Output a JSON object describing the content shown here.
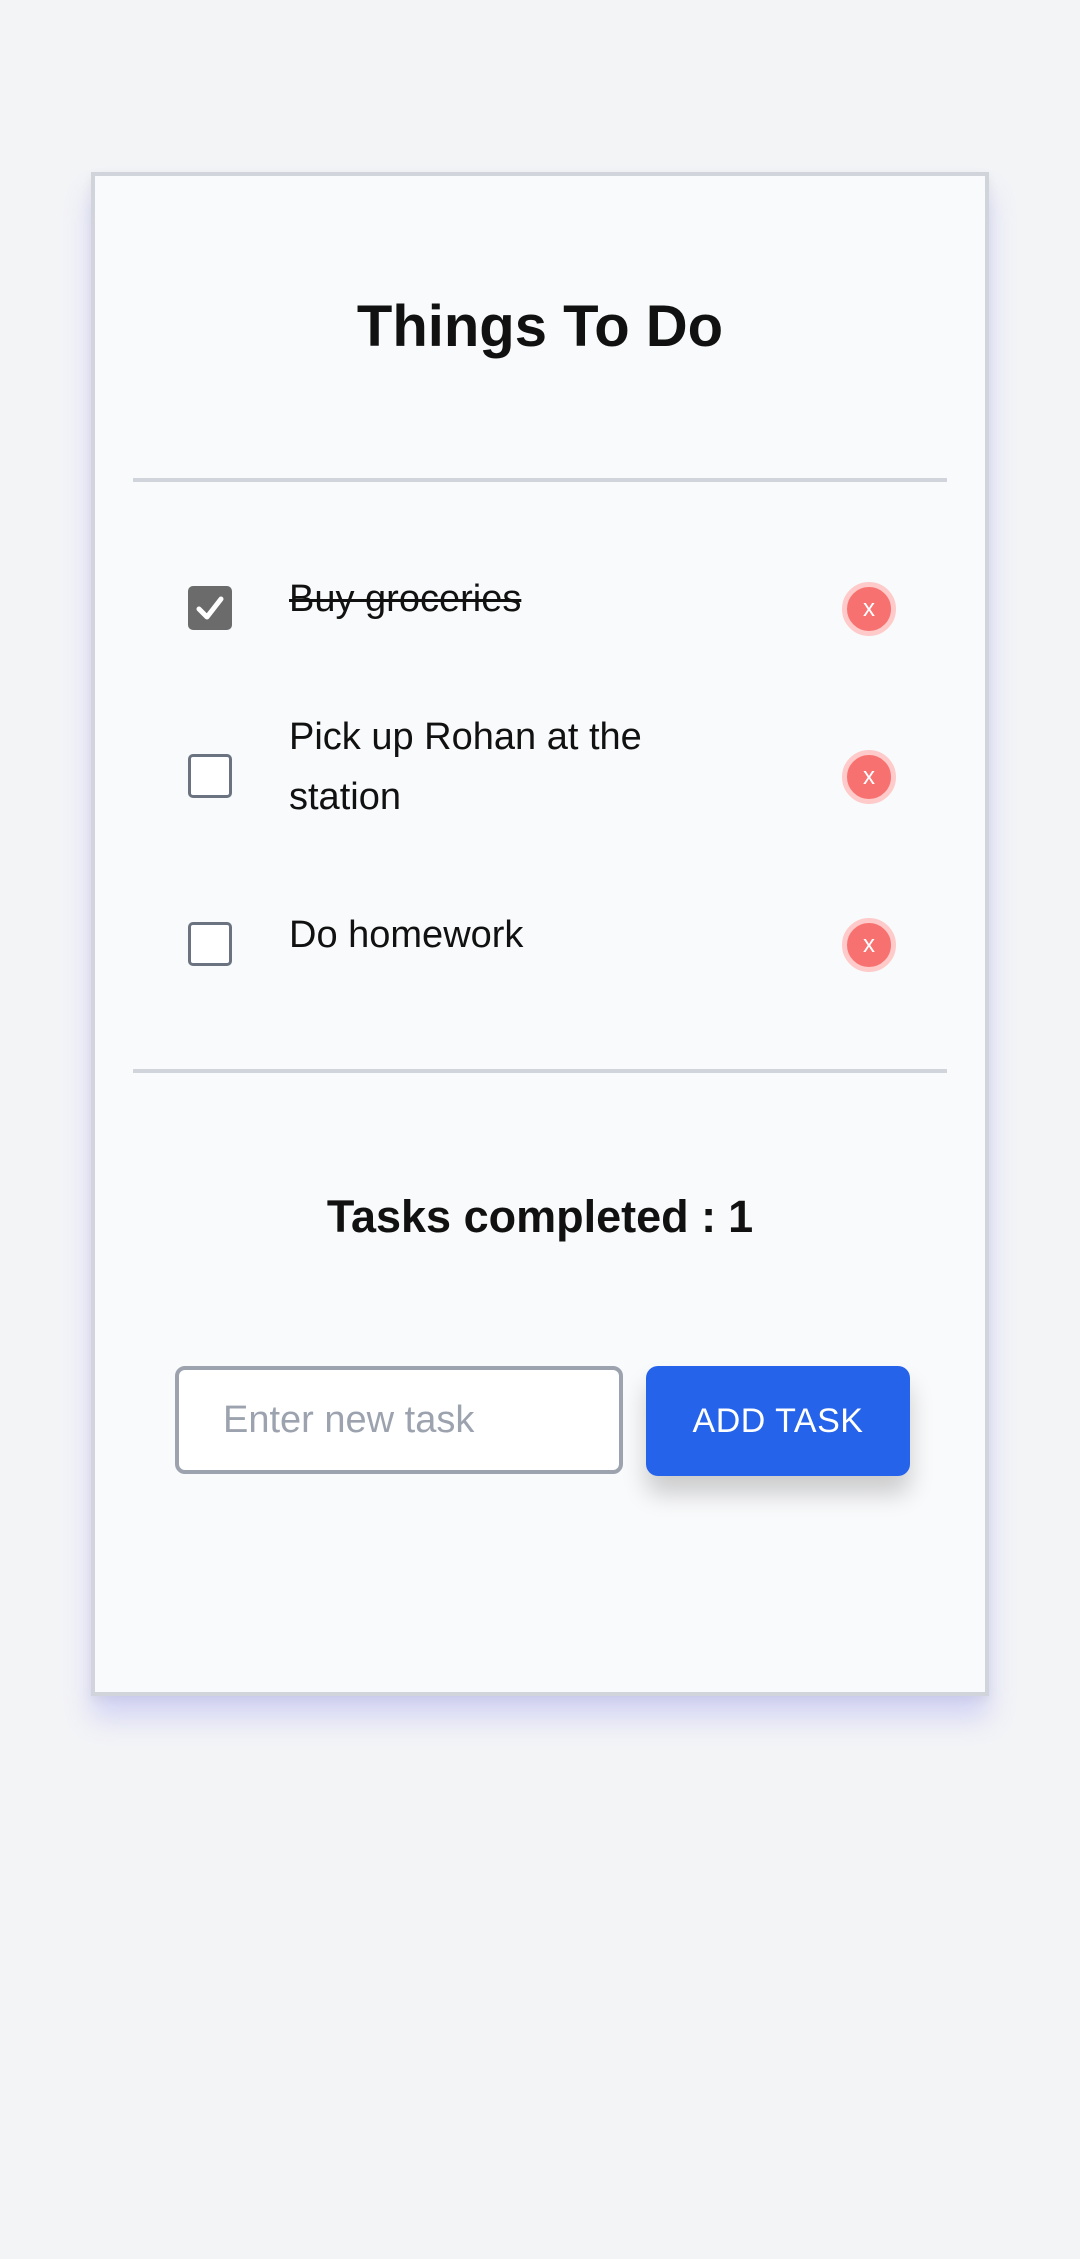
{
  "app": {
    "title": "Things To Do"
  },
  "tasks": [
    {
      "label": "Buy groceries",
      "completed": true
    },
    {
      "label": "Pick up Rohan at the station",
      "completed": false
    },
    {
      "label": "Do homework",
      "completed": false
    }
  ],
  "delete_label": "x",
  "summary": {
    "label": "Tasks completed :",
    "count": "1"
  },
  "new_task": {
    "placeholder": "Enter new task",
    "value": "",
    "button_label": "ADD TASK"
  },
  "colors": {
    "background": "#f3f4f6",
    "card": "#f9fafb",
    "accent": "#2563eb",
    "delete": "#f87171",
    "checked": "#6b6b6b"
  }
}
